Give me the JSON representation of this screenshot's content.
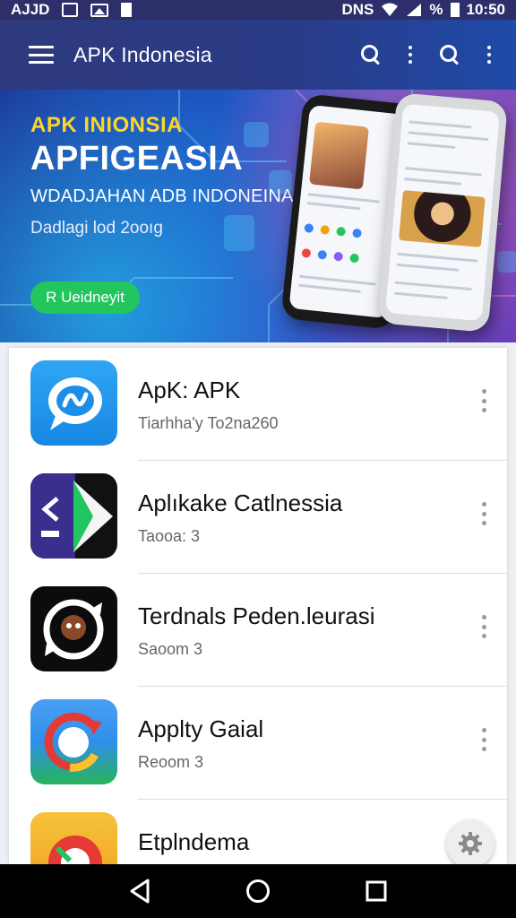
{
  "status_bar": {
    "left_text": "AJJD",
    "right_text": "DNS",
    "battery": "%",
    "time": "10:50"
  },
  "app_bar": {
    "title": "APK Indonesia",
    "icons": [
      "menu-icon",
      "search-icon",
      "more-icon",
      "search-icon",
      "more-icon"
    ]
  },
  "banner": {
    "tag": "APK INIONSIA",
    "headline": "APFIGEASIA",
    "subtitle": "WDADJAHAN ADB INDONEINA",
    "note": "Dadlagi lod 2ooıg",
    "button_label": "R Ueidneyit"
  },
  "apps": [
    {
      "name": "ApK: APK",
      "meta": "Tiarhha'y To2na260",
      "icon": "chat-bubble-icon"
    },
    {
      "name": "Aplıkake Catlnessia",
      "meta": "Taooa: 3",
      "icon": "arrow-play-icon"
    },
    {
      "name": "Terdnals Peden.leurasi",
      "meta": "Saoom 3",
      "icon": "refresh-monkey-icon"
    },
    {
      "name": "Applty Gaial",
      "meta": "Reoom 3",
      "icon": "circular-arrow-icon"
    },
    {
      "name": "Etplndema",
      "meta": "",
      "icon": "sticker-icon"
    }
  ],
  "colors": {
    "status_bar": "#2c2f6a",
    "app_bar": "#2a3b86",
    "accent_button": "#22c55e",
    "banner_tag": "#ffd52a"
  },
  "nav_bar": {
    "icons": [
      "back-icon",
      "home-icon",
      "recents-icon"
    ]
  }
}
